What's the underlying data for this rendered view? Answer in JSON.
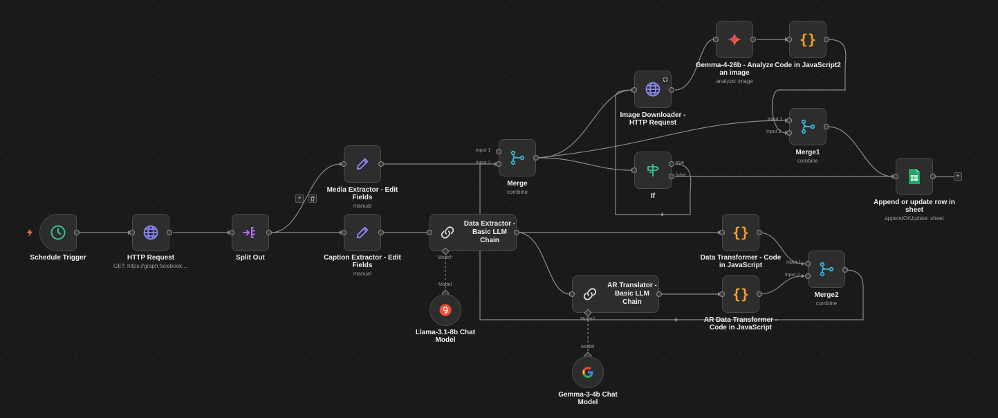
{
  "nodes": {
    "schedule_trigger": {
      "label": "Schedule Trigger",
      "icon": "clock-icon"
    },
    "http_request": {
      "label": "HTTP Request",
      "sub": "GET: https://graph.facebook....",
      "icon": "globe-icon"
    },
    "split_out": {
      "label": "Split Out",
      "icon": "split-out-icon"
    },
    "media_extractor": {
      "label": "Media Extractor - Edit Fields",
      "sub": "manual",
      "icon": "pencil-icon"
    },
    "caption_extractor": {
      "label": "Caption Extractor - Edit Fields",
      "sub": "manual",
      "icon": "pencil-icon"
    },
    "merge": {
      "label": "Merge",
      "sub": "combine",
      "icon": "merge-icon"
    },
    "data_extractor": {
      "label": "Data Extractor - Basic LLM Chain",
      "icon": "link-icon"
    },
    "llama": {
      "label": "Llama-3.1-8b Chat Model",
      "icon": "groq-icon"
    },
    "image_downloader": {
      "label": "Image Downloader - HTTP Request",
      "icon": "globe-icon"
    },
    "if": {
      "label": "If",
      "icon": "signpost-icon"
    },
    "gemma_analyze": {
      "label": "Gemma-4-26b - Analyze an image",
      "sub": "analyze: image",
      "icon": "gemini-icon"
    },
    "code_js2": {
      "label": "Code in JavaScript2",
      "icon": "braces-icon"
    },
    "merge1": {
      "label": "Merge1",
      "sub": "combine",
      "icon": "merge-icon"
    },
    "append_sheet": {
      "label": "Append or update row in sheet",
      "sub": "appendOrUpdate: sheet",
      "icon": "sheets-icon"
    },
    "data_transformer": {
      "label": "Data Transformer - Code in JavaScript",
      "icon": "braces-icon"
    },
    "ar_translator": {
      "label": "AR Translator - Basic LLM Chain",
      "icon": "link-icon"
    },
    "ar_data_transformer": {
      "label": "AR Data Transformer - Code in JavaScript",
      "icon": "braces-icon"
    },
    "merge2": {
      "label": "Merge2",
      "sub": "combine",
      "icon": "merge-icon"
    },
    "gemma_chat": {
      "label": "Gemma-3-4b Chat Model",
      "icon": "google-icon"
    }
  },
  "ports": {
    "input1": "Input 1",
    "input2": "Input 2",
    "true": "true",
    "false": "false",
    "model": "Model"
  },
  "controls": {
    "plus": "+",
    "trash": "🗑"
  },
  "colors": {
    "background": "#1a1a1a",
    "node": "#2d2d2e",
    "edge": "#8a8a8a",
    "trigger_accent": "#ff6d5a",
    "clock": "#35c39a",
    "globe": "#8b88f5",
    "pencil": "#8b88f5",
    "split": "#b36cf5",
    "merge": "#3fb6d8",
    "code": "#f6a12a",
    "if": "#35c39a",
    "sheets": "#23a566"
  }
}
